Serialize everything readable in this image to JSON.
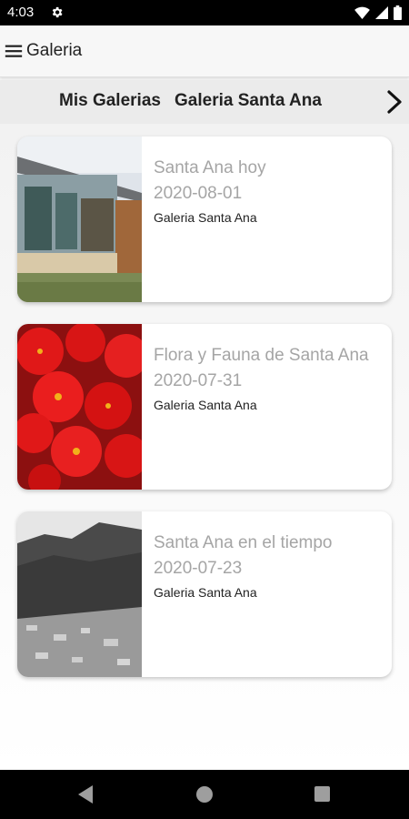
{
  "status_bar": {
    "time": "4:03"
  },
  "app_bar": {
    "title": "Galeria"
  },
  "tabs": [
    {
      "label": "Mis Galerias"
    },
    {
      "label": "Galeria Santa Ana"
    }
  ],
  "cards": [
    {
      "title": "Santa Ana hoy",
      "date": "2020-08-01",
      "subtitle": "Galeria Santa Ana"
    },
    {
      "title": "Flora y Fauna de Santa Ana",
      "date": "2020-07-31",
      "subtitle": "Galeria Santa Ana"
    },
    {
      "title": "Santa Ana en el tiempo",
      "date": "2020-07-23",
      "subtitle": "Galeria Santa Ana"
    }
  ],
  "icons": {
    "status": [
      "gear-icon",
      "wifi-icon",
      "signal-icon",
      "battery-icon"
    ],
    "app_bar": "menu-icon",
    "tab_strip": "chevron-right-icon",
    "nav": [
      "back-icon",
      "home-icon",
      "recents-icon"
    ]
  }
}
